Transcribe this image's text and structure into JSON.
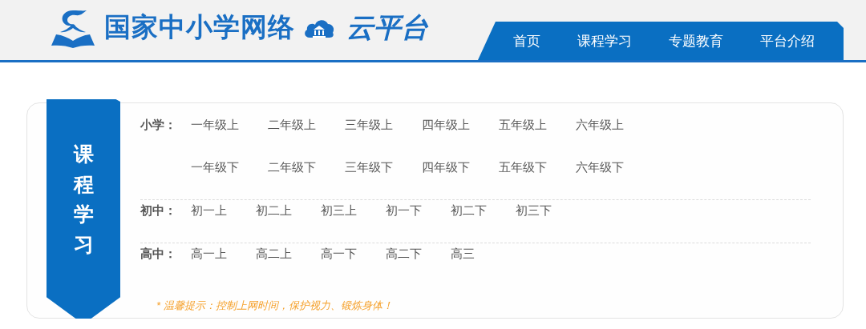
{
  "header": {
    "site_title": "国家中小学网络",
    "logo_text": "云平台"
  },
  "nav": [
    {
      "label": "首页"
    },
    {
      "label": "课程学习"
    },
    {
      "label": "专题教育"
    },
    {
      "label": "平台介绍"
    }
  ],
  "course_panel": {
    "title": "课程学习",
    "sections": [
      {
        "label": "小学：",
        "rows": [
          [
            "一年级上",
            "二年级上",
            "三年级上",
            "四年级上",
            "五年级上",
            "六年级上"
          ],
          [
            "一年级下",
            "二年级下",
            "三年级下",
            "四年级下",
            "五年级下",
            "六年级下"
          ]
        ]
      },
      {
        "label": "初中：",
        "rows": [
          [
            "初一上",
            "初二上",
            "初三上",
            "初一下",
            "初二下",
            "初三下"
          ]
        ]
      },
      {
        "label": "高中：",
        "rows": [
          [
            "高一上",
            "高二上",
            "高一下",
            "高二下",
            "高三"
          ]
        ]
      }
    ],
    "note": "* 温馨提示：控制上网时间，保护视力、锻炼身体！"
  }
}
